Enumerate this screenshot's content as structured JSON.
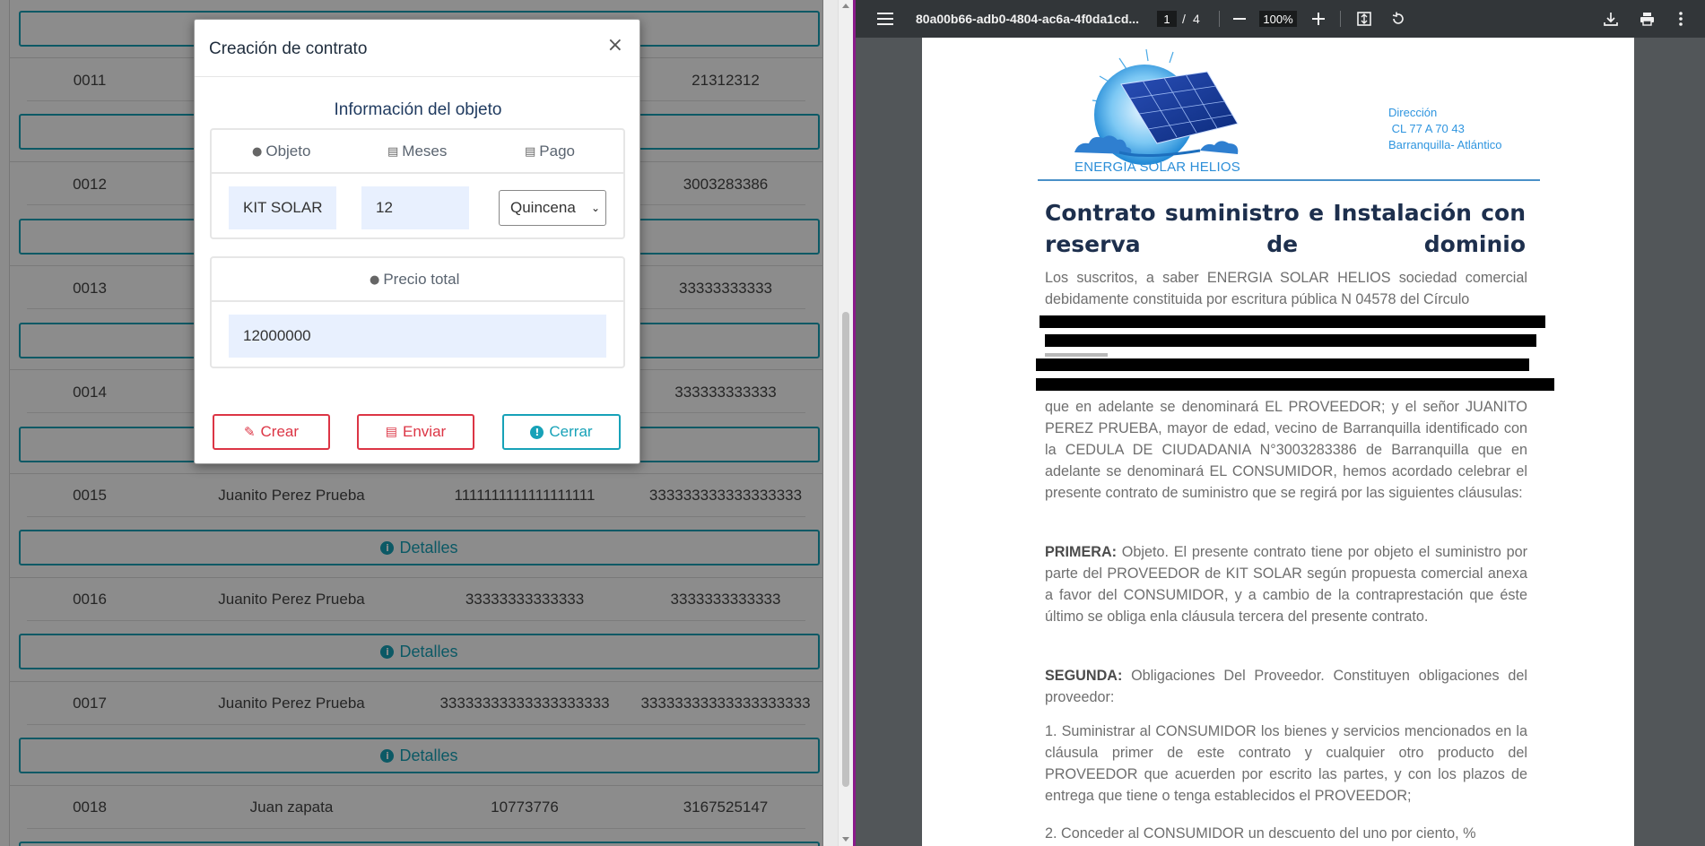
{
  "left_table": {
    "rows": [
      {
        "id": "0011",
        "name": "",
        "doc": "",
        "phone": "21312312"
      },
      {
        "id": "0012",
        "name": "",
        "doc": "",
        "phone": "3003283386"
      },
      {
        "id": "0013",
        "name": "",
        "doc": "",
        "phone": "33333333333"
      },
      {
        "id": "0014",
        "name": "",
        "doc": "",
        "phone": "333333333333"
      },
      {
        "id": "0015",
        "name": "Juanito Perez Prueba",
        "doc": "1111111111111111111",
        "phone": "333333333333333333"
      },
      {
        "id": "0016",
        "name": "Juanito Perez Prueba",
        "doc": "33333333333333",
        "phone": "3333333333333"
      },
      {
        "id": "0017",
        "name": "Juanito Perez Prueba",
        "doc": "33333333333333333333",
        "phone": "33333333333333333333"
      },
      {
        "id": "0018",
        "name": "Juan zapata",
        "doc": "10773776",
        "phone": "3167525147"
      }
    ],
    "details_label": "Detalles"
  },
  "modal": {
    "title": "Creación de contrato",
    "close": "×",
    "section_title": "Información del objeto",
    "headers": {
      "object": "Objeto",
      "months": "Meses",
      "payment": "Pago"
    },
    "object_value": "KIT SOLAR",
    "months_value": "12",
    "payment_selected": "Quincena",
    "total_header": "Precio total",
    "total_value": "12000000",
    "buttons": {
      "create": "Crear",
      "send": "Enviar",
      "close": "Cerrar"
    },
    "colors": {
      "danger": "#dc3545",
      "info": "#17a2b8"
    }
  },
  "viewer": {
    "doc_title": "80a00b66-adb0-4804-ac6a-4f0da1cd...",
    "page_current": "1",
    "page_sep": "/",
    "page_total": "4",
    "zoom": "100%"
  },
  "pdf": {
    "logo_text": "ENERGIA SOLAR HELIOS",
    "address_label": "Dirección",
    "address_line1": " CL 77 A 70 43",
    "address_line2": "Barranquilla- Atlántico",
    "title": "Contrato suministro e Instalación con reserva de dominio",
    "intro_top": "Los suscritos, a saber ENERGIA SOLAR HELIOS sociedad comercial debidamente constituida por escritura pública N 04578 del Círculo",
    "intro_bottom": "que en adelante se denominará EL PROVEEDOR; y el señor JUANITO PEREZ PRUEBA, mayor de edad, vecino de Barranquilla identificado con la CEDULA DE CIUDADANIA N°3003283386 de Barranquilla que en adelante se denominará EL CONSUMIDOR, hemos acordado celebrar el presente contrato de suministro que se regirá por las siguientes cláusulas:",
    "first_label": "PRIMERA:",
    "first_text": " Objeto. El presente contrato tiene por objeto el suministro por parte del PROVEEDOR de KIT SOLAR según propuesta comercial anexa a favor del CONSUMIDOR, y a cambio de la contraprestación que éste último se obliga enla cláusula tercera del presente contrato.",
    "second_label": "SEGUNDA:",
    "second_text": " Obligaciones Del Proveedor. Constituyen obligaciones del proveedor:",
    "item1": "1. Suministrar al CONSUMIDOR los bienes y servicios mencionados en la cláusula primer de este contrato y cualquier otro producto del PROVEEDOR que acuerden por escrito las partes, y con los plazos de entrega que tiene o tenga establecidos el PROVEEDOR;",
    "item2": "2. Conceder al CONSUMIDOR un descuento del uno por ciento, %"
  }
}
